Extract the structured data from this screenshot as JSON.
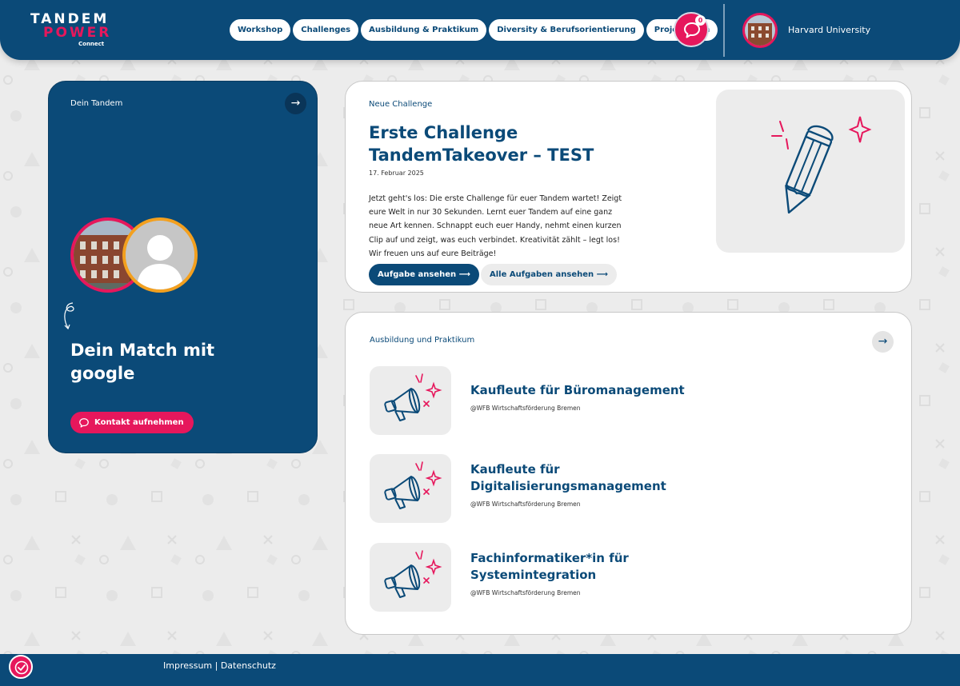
{
  "logo": {
    "line1": "TANDEM",
    "line2": "POWER",
    "line3": "Connect"
  },
  "nav": {
    "items": [
      {
        "label": "Workshop"
      },
      {
        "label": "Challenges"
      },
      {
        "label": "Ausbildung & Praktikum"
      },
      {
        "label": "Diversity & Berufsorientierung"
      },
      {
        "label": "Projektteam"
      }
    ]
  },
  "header": {
    "chat_badge": "0",
    "profile_name": "Harvard University"
  },
  "tandem": {
    "label": "Dein Tandem",
    "match_title": "Dein Match mit google",
    "contact_label": "Kontakt aufnehmen"
  },
  "challenge": {
    "label": "Neue Challenge",
    "title": "Erste Challenge TandemTakeover – TEST",
    "date": "17. Februar 2025",
    "text": "Jetzt geht's los: Die erste Challenge für euer Tandem wartet! Zeigt eure Welt in nur 30 Sekunden. Lernt euer Tandem auf eine ganz neue Art kennen. Schnappt euch euer Handy, nehmt einen kurzen Clip auf und zeigt, was euch verbindet. Kreativität zählt – legt los! Wir freuen uns auf eure Beiträge!",
    "primary_button": "Aufgabe ansehen",
    "secondary_button": "Alle Aufgaben ansehen"
  },
  "ausbildung": {
    "label": "Ausbildung und Praktikum",
    "items": [
      {
        "title": "Kaufleute für Büromanagement",
        "org": "@WFB Wirtschaftsförderung Bremen"
      },
      {
        "title": "Kaufleute für Digitalisierungsmanagement",
        "org": "@WFB Wirtschaftsförderung Bremen"
      },
      {
        "title": "Fachinformatiker*in für Systemintegration",
        "org": "@WFB Wirtschaftsförderung Bremen"
      }
    ]
  },
  "footer": {
    "links": "Impressum | Datenschutz"
  },
  "colors": {
    "primary": "#0b4a78",
    "accent": "#e6175c",
    "secondary_accent": "#f3a01f",
    "background": "#ececec"
  },
  "icons": [
    "arrow-right-icon",
    "chat-bubble-icon",
    "pencil-illustration-icon",
    "megaphone-icon",
    "accessibility-icon",
    "squiggle-arrow-icon"
  ]
}
